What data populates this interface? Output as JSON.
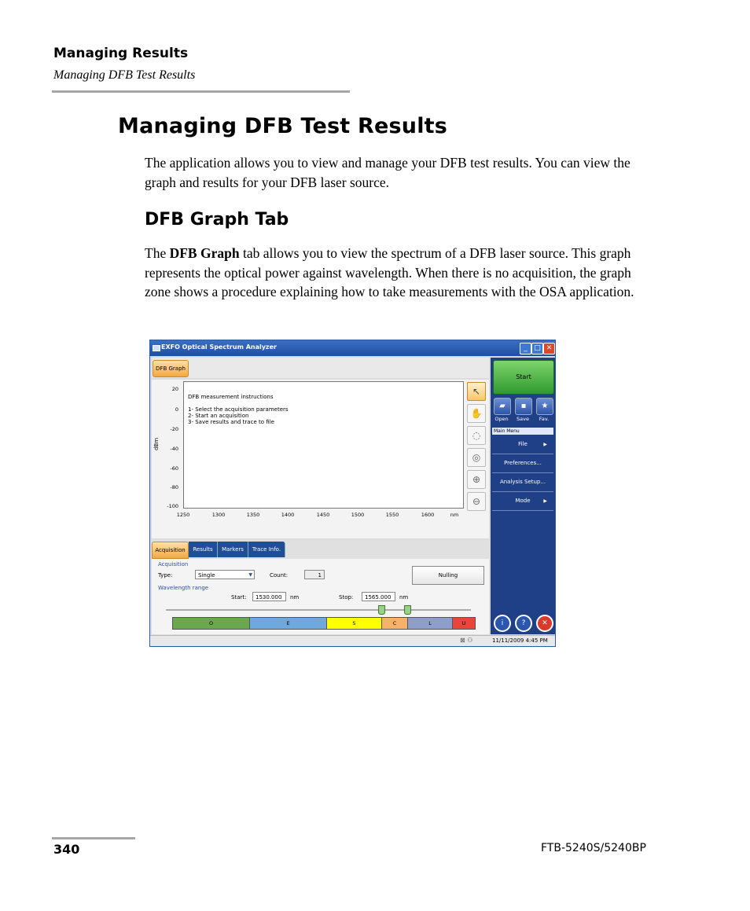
{
  "header": {
    "section": "Managing Results",
    "subsection": "Managing DFB Test Results"
  },
  "title": "Managing DFB Test Results",
  "intro": "The application allows you to view and manage your DFB test results. You can view the graph and results for your DFB laser source.",
  "subheading": "DFB Graph Tab",
  "para2_prefix": "The ",
  "para2_bold": "DFB Graph",
  "para2_rest": " tab allows you to view the spectrum of a DFB laser source. This graph represents the optical power against wavelength. When there is no acquisition, the graph zone shows a procedure explaining how to take measurements with the OSA application.",
  "screenshot": {
    "window_title": "EXFO Optical Spectrum Analyzer",
    "top_tab": "DFB Graph",
    "graph": {
      "y_ticks": [
        "20",
        "0",
        "-20",
        "-40",
        "-60",
        "-80",
        "-100"
      ],
      "y_unit": "dBm",
      "x_ticks": [
        "1250",
        "1300",
        "1350",
        "1400",
        "1450",
        "1500",
        "1550",
        "1600"
      ],
      "x_unit": "nm",
      "instructions": [
        "DFB measurement instructions",
        "",
        "1- Select the acquisition parameters",
        "2- Start an acquisition",
        "3- Save results and trace to file"
      ]
    },
    "tools": [
      "pointer-icon",
      "hand-icon",
      "zoom-area-icon",
      "zoom-fit-icon",
      "zoom-in-icon",
      "zoom-out-icon"
    ],
    "bottom_tabs": [
      "Acquisition",
      "Results",
      "Markers",
      "Trace Info."
    ],
    "acquisition": {
      "group_label": "Acquisition",
      "type_label": "Type:",
      "type_value": "Single",
      "count_label": "Count:",
      "count_value": "1",
      "nulling_label": "Nulling",
      "wl_group_label": "Wavelength range",
      "start_label": "Start:",
      "start_value": "1530.000",
      "stop_label": "Stop:",
      "stop_value": "1565.000",
      "unit": "nm",
      "bands": [
        {
          "label": "O",
          "color": "#6aa84f"
        },
        {
          "label": "E",
          "color": "#6fa8dc"
        },
        {
          "label": "S",
          "color": "#ffff00"
        },
        {
          "label": "C",
          "color": "#f6b26b"
        },
        {
          "label": "L",
          "color": "#8e9ecb"
        },
        {
          "label": "U",
          "color": "#e8453c"
        }
      ]
    },
    "right_panel": {
      "start": "Start",
      "quick": [
        {
          "label": "Open",
          "icon": "folder-icon"
        },
        {
          "label": "Save",
          "icon": "save-icon"
        },
        {
          "label": "Fav.",
          "icon": "star-icon"
        }
      ],
      "menu_title": "Main Menu",
      "menu": [
        "File",
        "Preferences...",
        "Analysis Setup...",
        "Mode"
      ]
    },
    "status_time": "11/11/2009 4:45 PM"
  },
  "footer": {
    "page": "340",
    "doc": "FTB-5240S/5240BP"
  }
}
